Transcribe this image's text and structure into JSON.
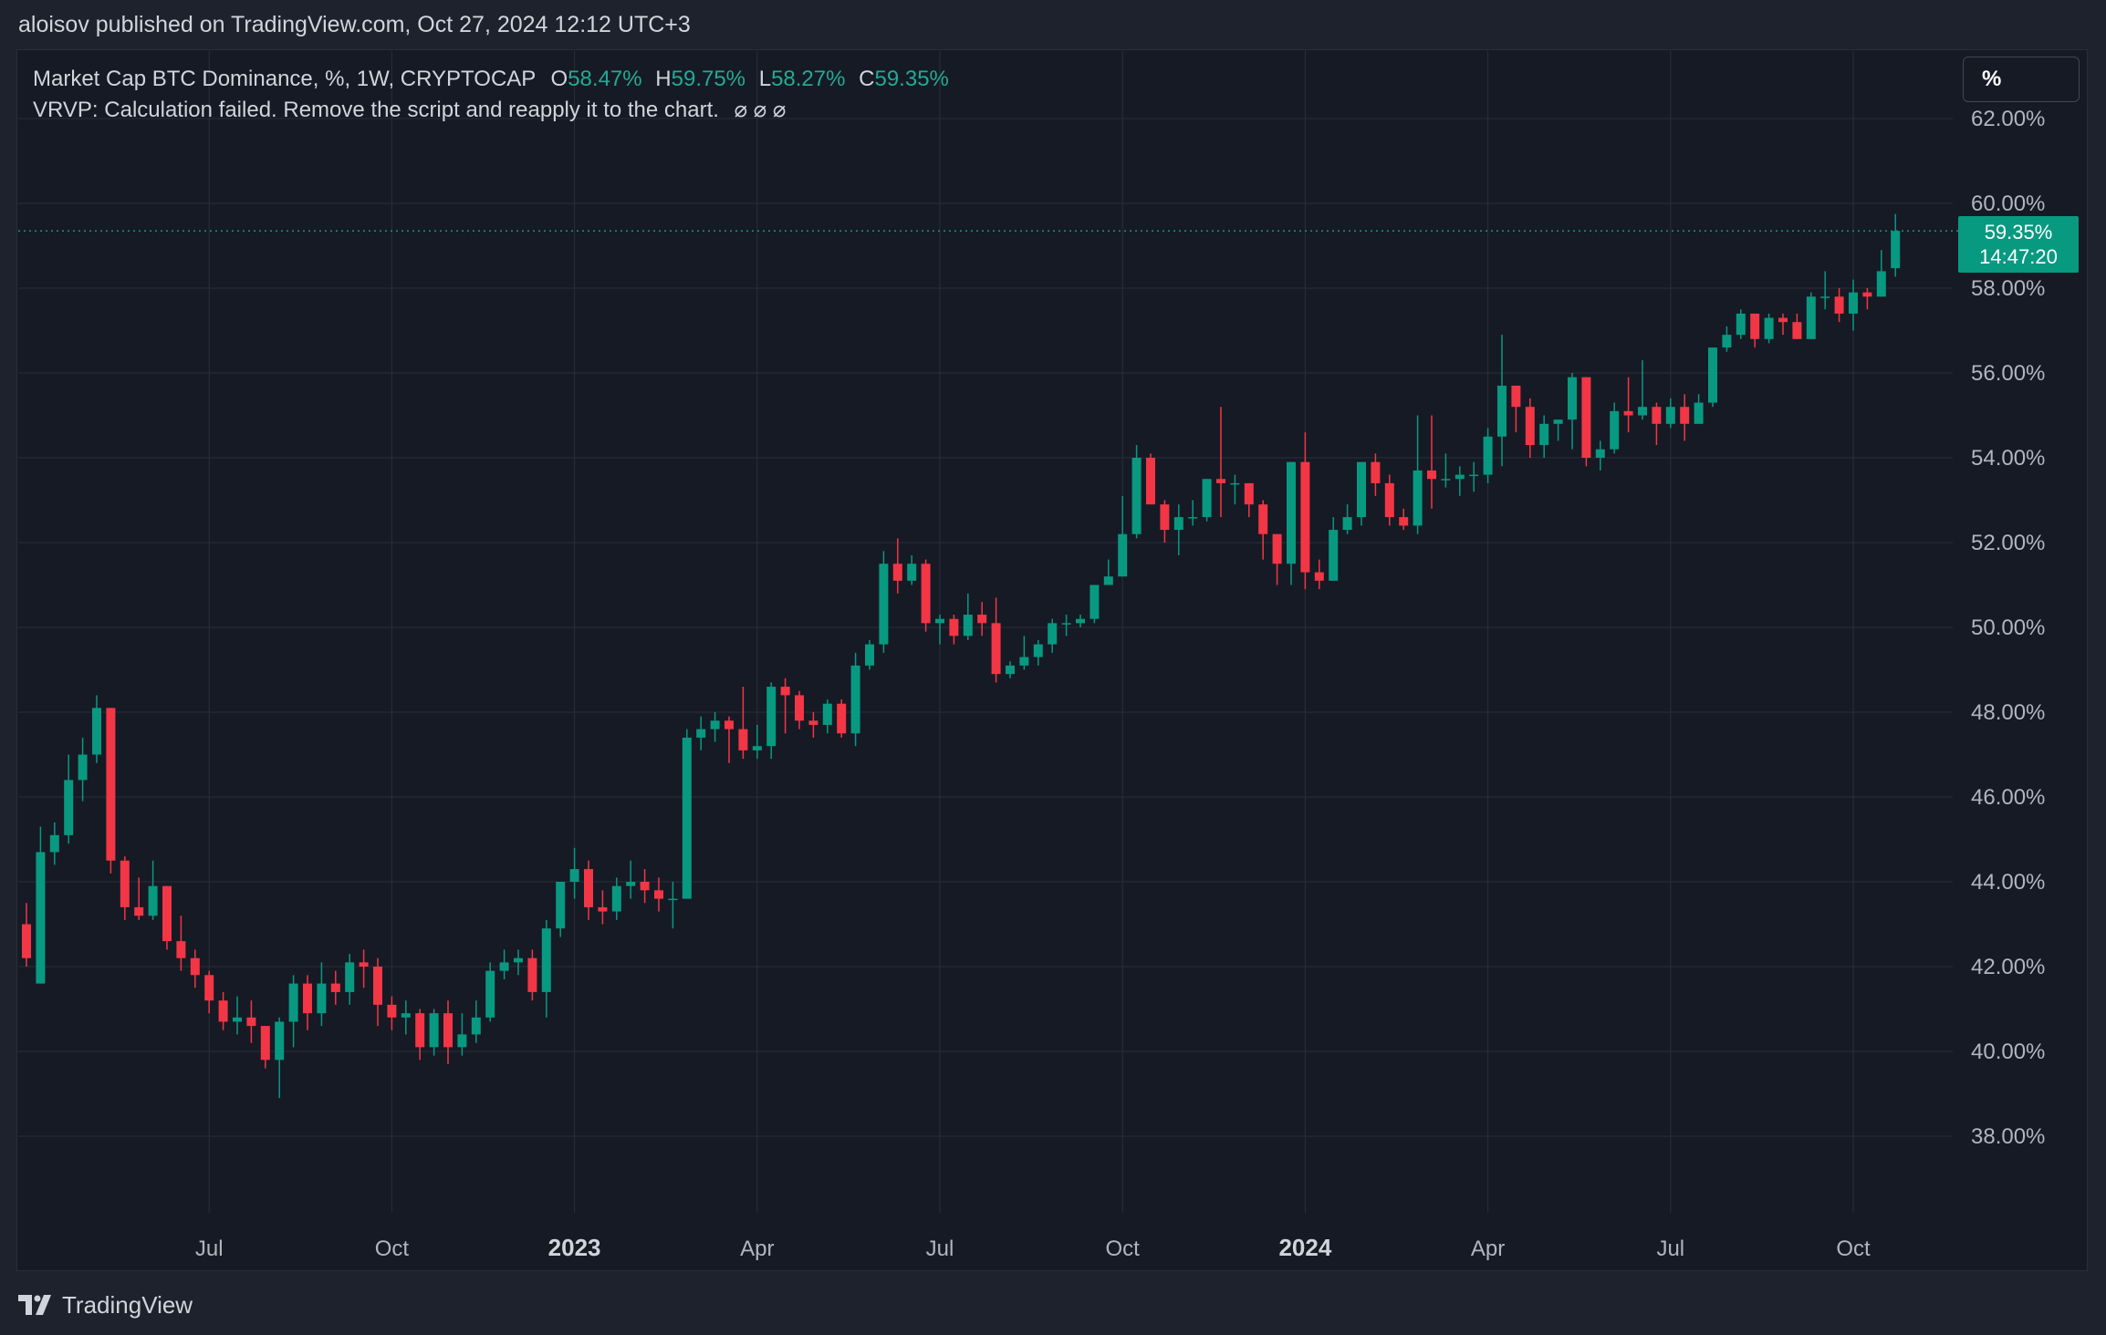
{
  "header": {
    "publisher_line": "aloisov published on TradingView.com, Oct 27, 2024 12:12 UTC+3"
  },
  "legend": {
    "symbol": "Market Cap BTC Dominance, %, 1W, CRYPTOCAP",
    "o_label": "O",
    "o_value": "58.47%",
    "h_label": "H",
    "h_value": "59.75%",
    "l_label": "L",
    "l_value": "58.27%",
    "c_label": "C",
    "c_value": "59.35%",
    "indicator_line": "VRVP: Calculation failed. Remove the script and reapply it to the chart.",
    "indicator_icons": "⌀ ⌀ ⌀"
  },
  "scale_mode": "%",
  "last_price": {
    "value": "59.35%",
    "countdown": "14:47:20"
  },
  "footer": {
    "brand": "TradingView"
  },
  "colors": {
    "up": "#089981",
    "down": "#f23645",
    "grid": "#2a2e39",
    "background": "#161a25",
    "axis_text": "#b2b5be"
  },
  "chart_data": {
    "type": "candlestick",
    "interval": "1W",
    "y_unit": "%",
    "ylim": [
      36.0,
      63.6
    ],
    "y_ticks": [
      "38.00%",
      "40.00%",
      "42.00%",
      "44.00%",
      "46.00%",
      "48.00%",
      "50.00%",
      "52.00%",
      "54.00%",
      "56.00%",
      "58.00%",
      "60.00%",
      "62.00%"
    ],
    "y_tick_values": [
      38,
      40,
      42,
      44,
      46,
      48,
      50,
      52,
      54,
      56,
      58,
      60,
      62
    ],
    "x_ticks": [
      {
        "label": "Jul",
        "bar": 13,
        "bold": false
      },
      {
        "label": "Oct",
        "bar": 26,
        "bold": false
      },
      {
        "label": "2023",
        "bar": 39,
        "bold": true
      },
      {
        "label": "Apr",
        "bar": 52,
        "bold": false
      },
      {
        "label": "Jul",
        "bar": 65,
        "bold": false
      },
      {
        "label": "Oct",
        "bar": 78,
        "bold": false
      },
      {
        "label": "2024",
        "bar": 91,
        "bold": true
      },
      {
        "label": "Apr",
        "bar": 104,
        "bold": false
      },
      {
        "label": "Jul",
        "bar": 117,
        "bold": false
      },
      {
        "label": "Oct",
        "bar": 130,
        "bold": false
      }
    ],
    "last_price_line": 59.35,
    "candles": [
      [
        43.0,
        42.2,
        42.0,
        43.5
      ],
      [
        41.6,
        44.7,
        41.6,
        45.3
      ],
      [
        44.7,
        45.1,
        44.4,
        45.4
      ],
      [
        45.1,
        46.4,
        44.9,
        47.0
      ],
      [
        46.4,
        47.0,
        45.9,
        47.4
      ],
      [
        47.0,
        48.1,
        46.8,
        48.4
      ],
      [
        48.1,
        44.5,
        44.2,
        48.1
      ],
      [
        44.5,
        43.4,
        43.1,
        44.6
      ],
      [
        43.4,
        43.2,
        43.1,
        44.1
      ],
      [
        43.2,
        43.9,
        43.1,
        44.5
      ],
      [
        43.9,
        42.6,
        42.4,
        43.9
      ],
      [
        42.6,
        42.2,
        41.9,
        43.2
      ],
      [
        42.2,
        41.8,
        41.5,
        42.4
      ],
      [
        41.8,
        41.2,
        40.9,
        41.9
      ],
      [
        41.2,
        40.7,
        40.5,
        41.4
      ],
      [
        40.7,
        40.8,
        40.4,
        41.3
      ],
      [
        40.8,
        40.6,
        40.2,
        41.2
      ],
      [
        40.6,
        39.8,
        39.6,
        40.6
      ],
      [
        39.8,
        40.7,
        38.9,
        40.8
      ],
      [
        40.7,
        41.6,
        40.1,
        41.8
      ],
      [
        41.6,
        40.9,
        40.5,
        41.8
      ],
      [
        40.9,
        41.6,
        40.6,
        42.1
      ],
      [
        41.6,
        41.4,
        41.1,
        41.9
      ],
      [
        41.4,
        42.1,
        41.1,
        42.3
      ],
      [
        42.1,
        42.0,
        41.5,
        42.4
      ],
      [
        42.0,
        41.1,
        40.6,
        42.2
      ],
      [
        41.1,
        40.8,
        40.5,
        41.3
      ],
      [
        40.8,
        40.9,
        40.4,
        41.2
      ],
      [
        40.9,
        40.1,
        39.8,
        41.0
      ],
      [
        40.1,
        40.9,
        39.9,
        41.0
      ],
      [
        40.9,
        40.1,
        39.7,
        41.2
      ],
      [
        40.1,
        40.4,
        39.9,
        40.9
      ],
      [
        40.4,
        40.8,
        40.2,
        41.2
      ],
      [
        40.8,
        41.9,
        40.7,
        42.1
      ],
      [
        41.9,
        42.1,
        41.7,
        42.4
      ],
      [
        42.1,
        42.2,
        41.8,
        42.4
      ],
      [
        42.2,
        41.4,
        41.2,
        42.4
      ],
      [
        41.4,
        42.9,
        40.8,
        43.1
      ],
      [
        42.9,
        44.0,
        42.7,
        44.0
      ],
      [
        44.0,
        44.3,
        43.6,
        44.8
      ],
      [
        44.3,
        43.4,
        43.1,
        44.5
      ],
      [
        43.4,
        43.3,
        43.0,
        43.8
      ],
      [
        43.3,
        43.9,
        43.1,
        44.1
      ],
      [
        43.9,
        44.0,
        43.6,
        44.5
      ],
      [
        44.0,
        43.8,
        43.5,
        44.3
      ],
      [
        43.8,
        43.6,
        43.3,
        44.1
      ],
      [
        43.6,
        43.6,
        42.9,
        44.0
      ],
      [
        43.6,
        47.4,
        43.6,
        47.6
      ],
      [
        47.4,
        47.6,
        47.1,
        47.9
      ],
      [
        47.6,
        47.8,
        47.3,
        48.0
      ],
      [
        47.8,
        47.6,
        46.8,
        47.9
      ],
      [
        47.6,
        47.1,
        46.9,
        48.6
      ],
      [
        47.1,
        47.2,
        46.9,
        47.7
      ],
      [
        47.2,
        48.6,
        46.9,
        48.7
      ],
      [
        48.6,
        48.4,
        47.5,
        48.8
      ],
      [
        48.4,
        47.8,
        47.6,
        48.5
      ],
      [
        47.8,
        47.7,
        47.4,
        48.0
      ],
      [
        47.7,
        48.2,
        47.5,
        48.3
      ],
      [
        48.2,
        47.5,
        47.4,
        48.3
      ],
      [
        47.5,
        49.1,
        47.2,
        49.4
      ],
      [
        49.1,
        49.6,
        49.0,
        49.7
      ],
      [
        49.6,
        51.5,
        49.4,
        51.8
      ],
      [
        51.5,
        51.1,
        50.8,
        52.1
      ],
      [
        51.1,
        51.5,
        51.0,
        51.7
      ],
      [
        51.5,
        50.1,
        49.9,
        51.6
      ],
      [
        50.1,
        50.2,
        49.6,
        50.3
      ],
      [
        50.2,
        49.8,
        49.6,
        50.3
      ],
      [
        49.8,
        50.3,
        49.7,
        50.8
      ],
      [
        50.3,
        50.1,
        49.8,
        50.6
      ],
      [
        50.1,
        48.9,
        48.7,
        50.7
      ],
      [
        48.9,
        49.1,
        48.8,
        49.2
      ],
      [
        49.1,
        49.3,
        49.0,
        49.8
      ],
      [
        49.3,
        49.6,
        49.1,
        49.7
      ],
      [
        49.6,
        50.1,
        49.4,
        50.2
      ],
      [
        50.1,
        50.1,
        49.8,
        50.3
      ],
      [
        50.1,
        50.2,
        50.0,
        50.3
      ],
      [
        50.2,
        51.0,
        50.1,
        51.0
      ],
      [
        51.0,
        51.2,
        51.0,
        51.6
      ],
      [
        51.2,
        52.2,
        51.2,
        53.1
      ],
      [
        52.2,
        54.0,
        52.1,
        54.3
      ],
      [
        54.0,
        52.9,
        52.9,
        54.1
      ],
      [
        52.9,
        52.3,
        52.0,
        53.0
      ],
      [
        52.3,
        52.6,
        51.7,
        52.9
      ],
      [
        52.6,
        52.6,
        52.4,
        53.0
      ],
      [
        52.6,
        53.5,
        52.5,
        53.5
      ],
      [
        53.5,
        53.4,
        52.6,
        55.2
      ],
      [
        53.4,
        53.4,
        52.9,
        53.6
      ],
      [
        53.4,
        52.9,
        52.6,
        53.4
      ],
      [
        52.9,
        52.2,
        51.6,
        53.0
      ],
      [
        52.2,
        51.5,
        51.0,
        52.2
      ],
      [
        51.5,
        53.9,
        51.0,
        53.9
      ],
      [
        53.9,
        51.3,
        50.9,
        54.6
      ],
      [
        51.3,
        51.1,
        50.9,
        51.6
      ],
      [
        51.1,
        52.3,
        51.1,
        52.6
      ],
      [
        52.3,
        52.6,
        52.2,
        52.9
      ],
      [
        52.6,
        53.9,
        52.4,
        53.9
      ],
      [
        53.9,
        53.4,
        53.1,
        54.1
      ],
      [
        53.4,
        52.6,
        52.4,
        53.6
      ],
      [
        52.6,
        52.4,
        52.3,
        52.8
      ],
      [
        52.4,
        53.7,
        52.2,
        55.0
      ],
      [
        53.7,
        53.5,
        52.8,
        55.0
      ],
      [
        53.5,
        53.5,
        53.3,
        54.1
      ],
      [
        53.5,
        53.6,
        53.1,
        53.8
      ],
      [
        53.6,
        53.6,
        53.2,
        53.9
      ],
      [
        53.6,
        54.5,
        53.4,
        54.7
      ],
      [
        54.5,
        55.7,
        53.8,
        56.9
      ],
      [
        55.7,
        55.2,
        54.6,
        55.7
      ],
      [
        55.2,
        54.3,
        54.0,
        55.4
      ],
      [
        54.3,
        54.8,
        54.0,
        55.0
      ],
      [
        54.8,
        54.9,
        54.4,
        54.9
      ],
      [
        54.9,
        55.9,
        54.2,
        56.0
      ],
      [
        55.9,
        54.0,
        53.8,
        55.9
      ],
      [
        54.0,
        54.2,
        53.7,
        54.4
      ],
      [
        54.2,
        55.1,
        54.1,
        55.3
      ],
      [
        55.1,
        55.0,
        54.6,
        55.9
      ],
      [
        55.0,
        55.2,
        54.9,
        56.3
      ],
      [
        55.2,
        54.8,
        54.3,
        55.3
      ],
      [
        54.8,
        55.2,
        54.7,
        55.4
      ],
      [
        55.2,
        54.8,
        54.4,
        55.5
      ],
      [
        54.8,
        55.3,
        54.8,
        55.5
      ],
      [
        55.3,
        56.6,
        55.2,
        56.6
      ],
      [
        56.6,
        56.9,
        56.5,
        57.1
      ],
      [
        56.9,
        57.4,
        56.8,
        57.5
      ],
      [
        57.4,
        56.8,
        56.6,
        57.4
      ],
      [
        56.8,
        57.3,
        56.7,
        57.4
      ],
      [
        57.3,
        57.2,
        56.9,
        57.4
      ],
      [
        57.2,
        56.8,
        56.8,
        57.4
      ],
      [
        56.8,
        57.8,
        56.8,
        57.9
      ],
      [
        57.8,
        57.8,
        57.5,
        58.4
      ],
      [
        57.8,
        57.4,
        57.2,
        58.0
      ],
      [
        57.4,
        57.9,
        57.0,
        58.2
      ],
      [
        57.9,
        57.8,
        57.5,
        58.0
      ],
      [
        57.8,
        58.4,
        57.8,
        58.9
      ],
      [
        58.47,
        59.35,
        58.27,
        59.75
      ]
    ]
  }
}
